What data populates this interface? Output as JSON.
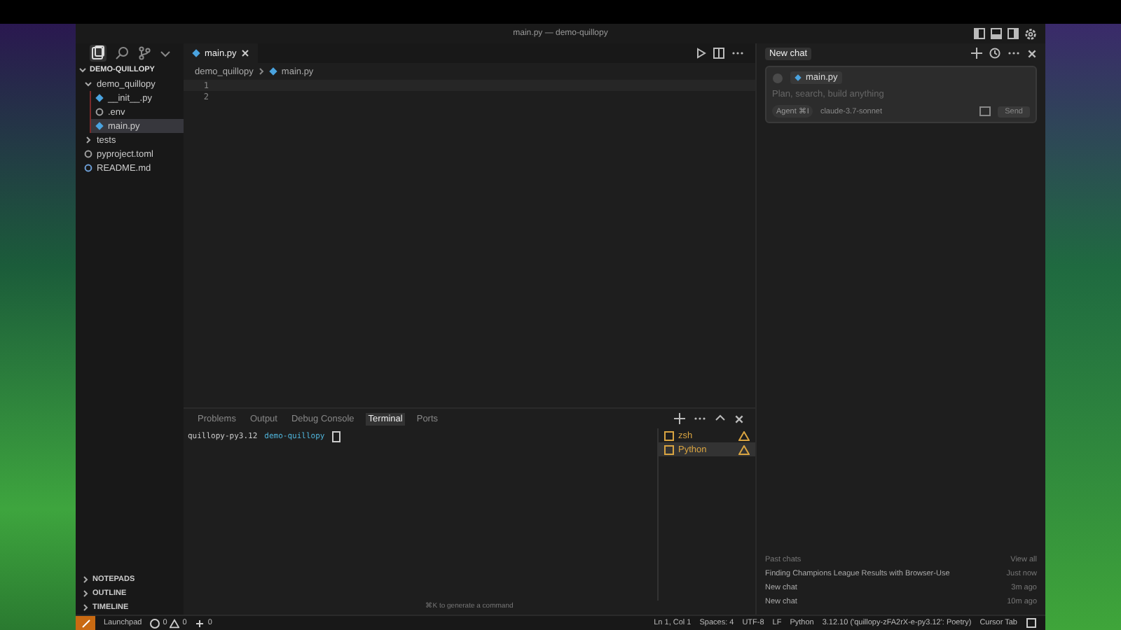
{
  "window": {
    "title": "main.py — demo-quillopy"
  },
  "sidebar": {
    "root": "DEMO-QUILLOPY",
    "tree": [
      {
        "label": "demo_quillopy",
        "kind": "folder",
        "expanded": true,
        "selected": false,
        "children": [
          {
            "label": "__init__.py",
            "kind": "python",
            "selected": false
          },
          {
            "label": ".env",
            "kind": "gear",
            "selected": false
          },
          {
            "label": "main.py",
            "kind": "python",
            "selected": true
          }
        ]
      },
      {
        "label": "tests",
        "kind": "folder",
        "expanded": false,
        "selected": false
      },
      {
        "label": "pyproject.toml",
        "kind": "gear",
        "selected": false
      },
      {
        "label": "README.md",
        "kind": "info",
        "selected": false
      }
    ],
    "sections": [
      "NOTEPADS",
      "OUTLINE",
      "TIMELINE"
    ]
  },
  "editor": {
    "tabs": [
      {
        "label": "main.py",
        "selected": true
      }
    ],
    "breadcrumbs": [
      "demo_quillopy",
      "main.py"
    ],
    "line_numbers": [
      "1",
      "2"
    ]
  },
  "panel": {
    "tabs": [
      {
        "label": "Problems",
        "selected": false
      },
      {
        "label": "Output",
        "selected": false
      },
      {
        "label": "Debug Console",
        "selected": false
      },
      {
        "label": "Terminal",
        "selected": true
      },
      {
        "label": "Ports",
        "selected": false
      }
    ],
    "prompt_env": "quillopy-py3.12",
    "prompt_dir": "demo-quillopy",
    "hint": "⌘K to generate a command",
    "terminals": [
      {
        "label": "zsh",
        "selected": false
      },
      {
        "label": "Python",
        "selected": true
      }
    ]
  },
  "chat": {
    "tab": "New chat",
    "context": "main.py",
    "placeholder": "Plan, search, build anything",
    "mode": "Agent",
    "mode_key": "⌘I",
    "model": "claude-3.7-sonnet",
    "send": "Send",
    "past_heading": "Past chats",
    "view_all": "View all",
    "past_chats": [
      {
        "title": "Finding Champions League Results with Browser-Use",
        "time": "Just now"
      },
      {
        "title": "New chat",
        "time": "3m ago"
      },
      {
        "title": "New chat",
        "time": "10m ago"
      }
    ]
  },
  "status_bar": {
    "launchpad": "Launchpad",
    "errors": "0",
    "warnings": "0",
    "ports": "0",
    "right": [
      "Ln 1, Col 1",
      "Spaces: 4",
      "UTF-8",
      "LF",
      "Python",
      "3.12.10 ('quillopy-zFA2rX-e-py3.12': Poetry)",
      "Cursor Tab"
    ]
  }
}
